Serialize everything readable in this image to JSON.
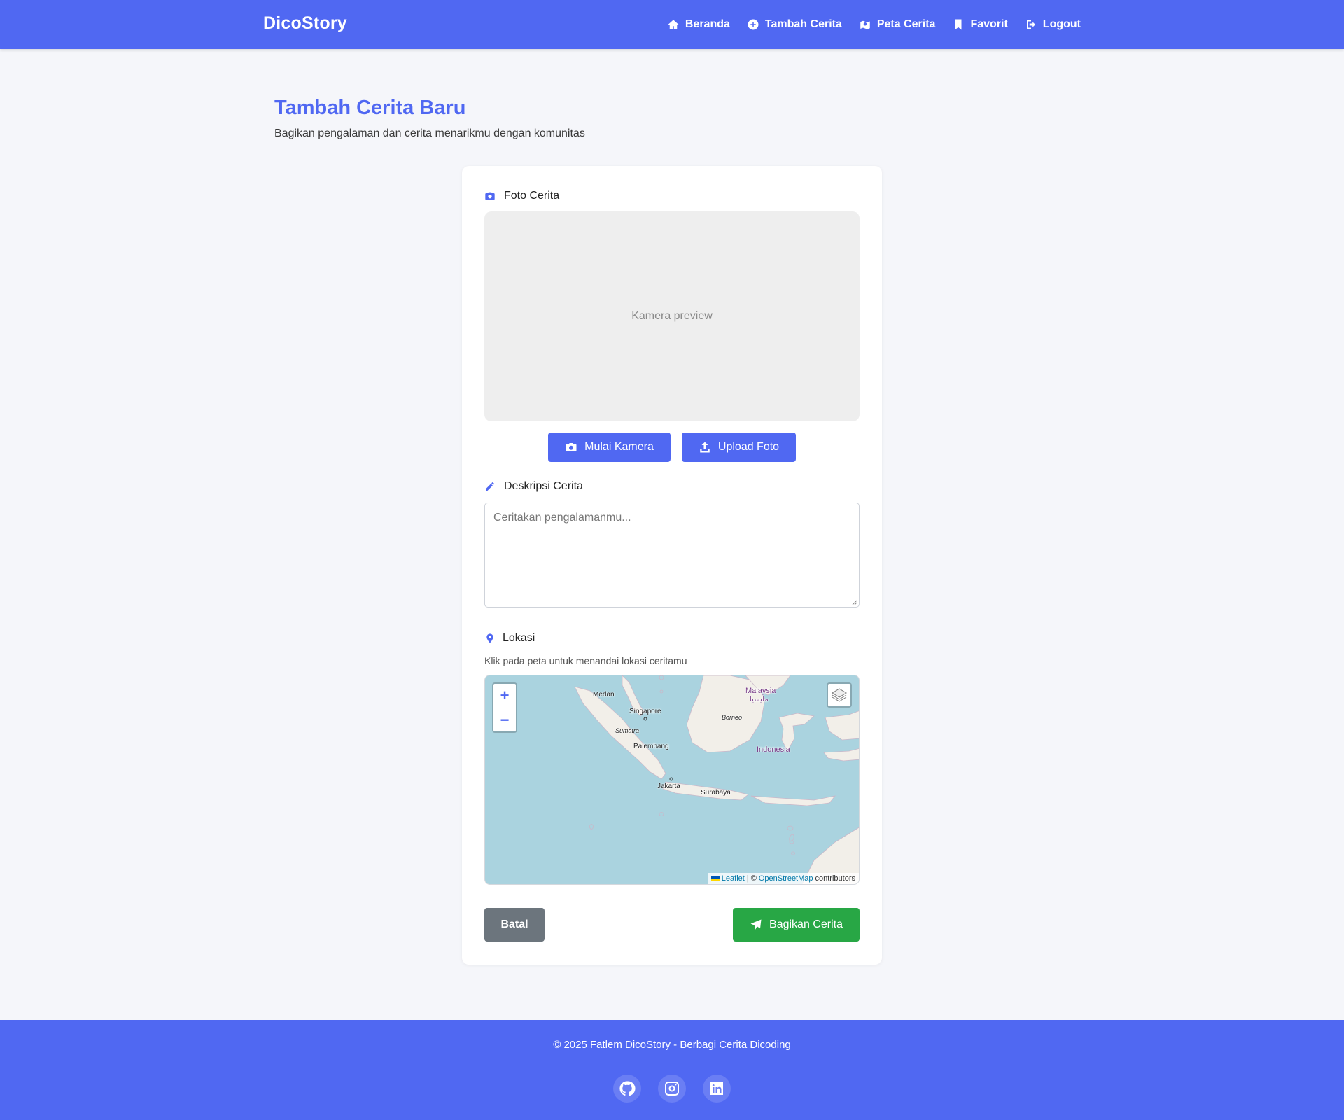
{
  "navbar": {
    "brand": "DicoStory",
    "links": [
      {
        "label": "Beranda",
        "icon": "home-icon"
      },
      {
        "label": "Tambah Cerita",
        "icon": "plus-circle-icon"
      },
      {
        "label": "Peta Cerita",
        "icon": "map-icon"
      },
      {
        "label": "Favorit",
        "icon": "bookmark-icon"
      },
      {
        "label": "Logout",
        "icon": "logout-icon"
      }
    ]
  },
  "header": {
    "title": "Tambah Cerita Baru",
    "subtitle": "Bagikan pengalaman dan cerita menarikmu dengan komunitas"
  },
  "form": {
    "photo_label": "Foto Cerita",
    "camera_preview_text": "Kamera preview",
    "start_camera_label": "Mulai Kamera",
    "upload_photo_label": "Upload Foto",
    "description_label": "Deskripsi Cerita",
    "description_placeholder": "Ceritakan pengalamanmu...",
    "location_label": "Lokasi",
    "location_hint": "Klik pada peta untuk menandai lokasi ceritamu",
    "cancel_label": "Batal",
    "submit_label": "Bagikan Cerita"
  },
  "map": {
    "zoom_in": "+",
    "zoom_out": "−",
    "attribution_leaflet": "Leaflet",
    "attribution_sep": "| ©",
    "attribution_osm": "OpenStreetMap",
    "attribution_contributors": "contributors",
    "labels": {
      "medan": "Medan",
      "singapore": "Singapore",
      "sumatra": "Sumatra",
      "palembang": "Palembang",
      "jakarta": "Jakarta",
      "surabaya": "Surabaya",
      "borneo": "Borneo",
      "indonesia": "Indonesia",
      "malaysia": "Malaysia",
      "malaysia_jawi": "مليسيا"
    }
  },
  "footer": {
    "text": "© 2025 Fatlem DicoStory - Berbagi Cerita Dicoding",
    "social": [
      "github-icon",
      "instagram-icon",
      "linkedin-icon"
    ]
  },
  "colors": {
    "primary": "#5068f2",
    "success": "#28a745",
    "secondary": "#6c757d",
    "background": "#f5f6fa",
    "sea": "#aad3df",
    "land": "#f2efe9"
  }
}
